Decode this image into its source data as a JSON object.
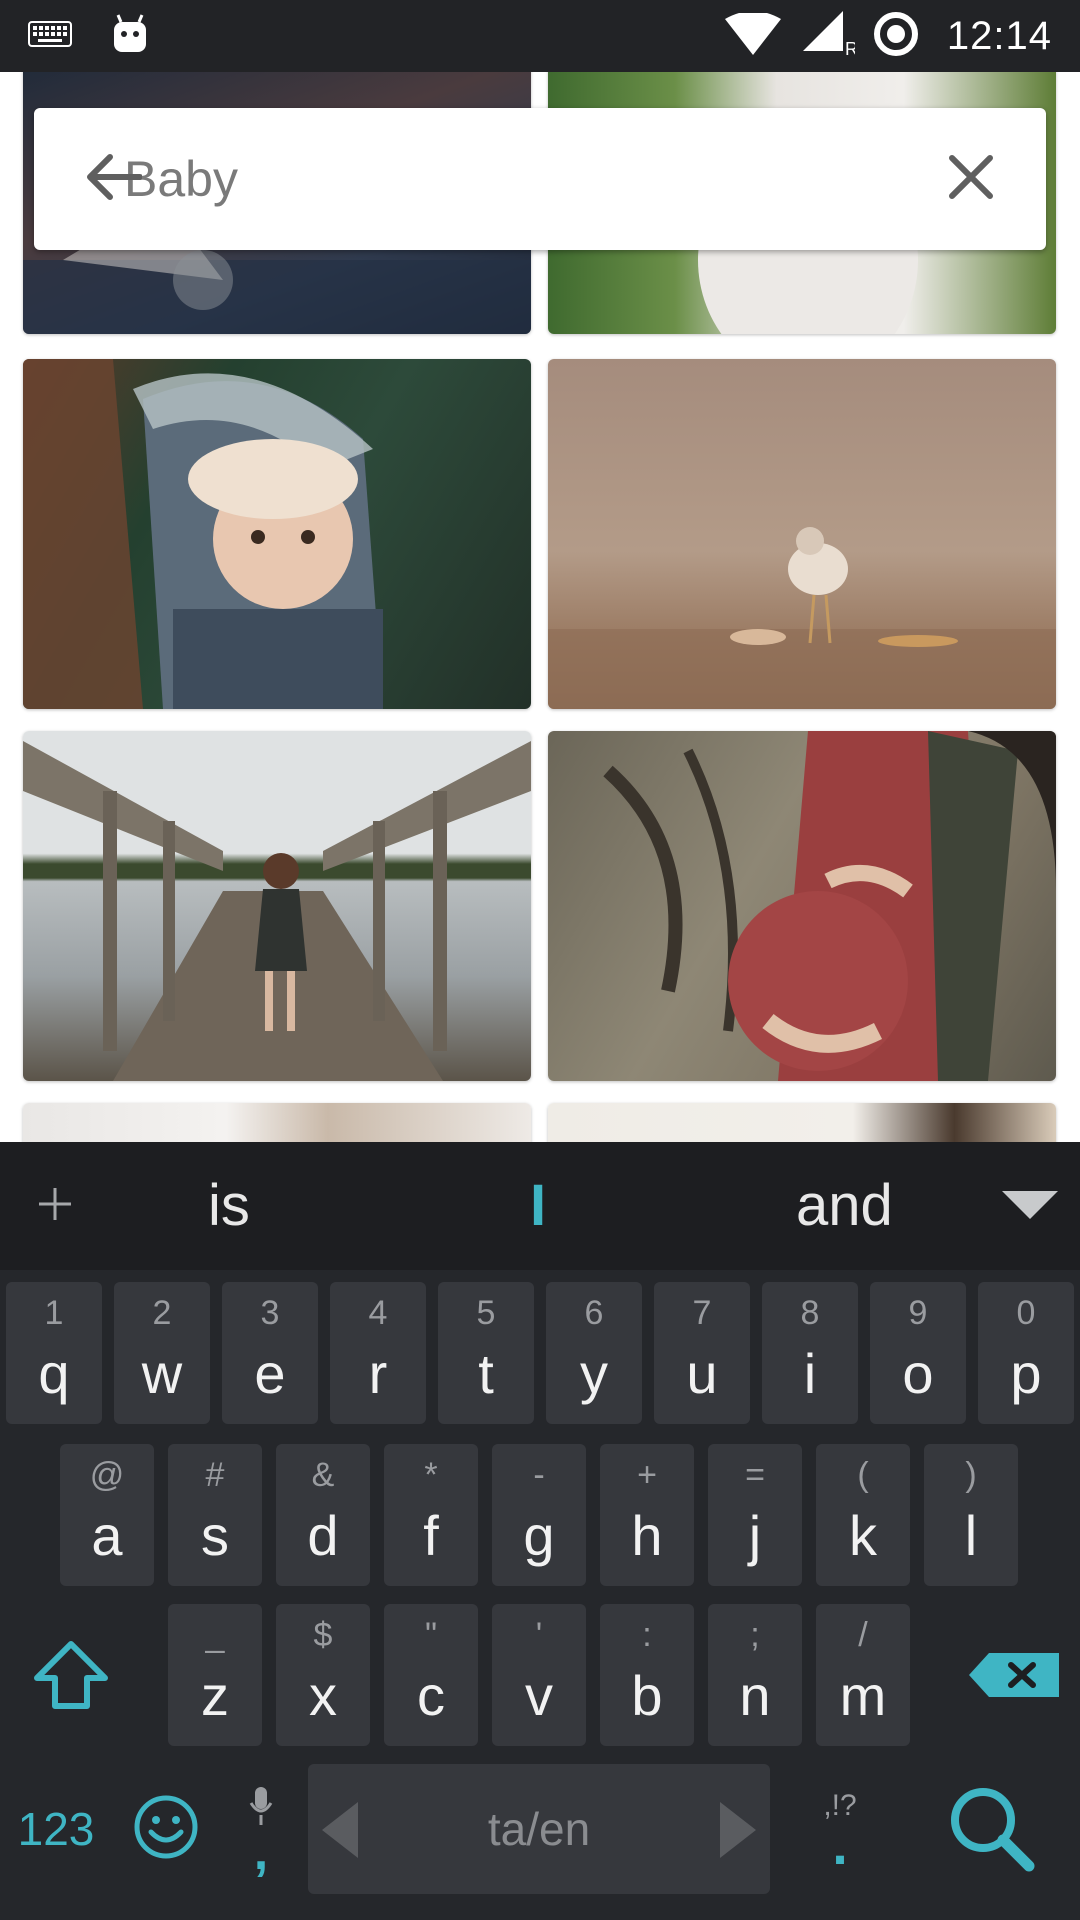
{
  "status_bar": {
    "time": "12:14",
    "icons": [
      "keyboard-icon",
      "android-icon",
      "wifi-icon",
      "signal-icon",
      "sync-icon"
    ]
  },
  "search": {
    "query": "Baby",
    "back_icon": "arrow-left-icon",
    "clear_icon": "close-icon"
  },
  "photos": [
    {
      "name": "photo-top-left",
      "colors": [
        "#2f3a4e",
        "#6b4a44"
      ]
    },
    {
      "name": "photo-top-right",
      "colors": [
        "#5a7a3a",
        "#e7e4e0"
      ]
    },
    {
      "name": "photo-baby-in-carrier",
      "colors": [
        "#2d4a3a",
        "#5b6b7a"
      ]
    },
    {
      "name": "photo-bird-on-sand",
      "colors": [
        "#b39b88",
        "#9a7a62"
      ]
    },
    {
      "name": "photo-child-on-pier",
      "colors": [
        "#dfe2e3",
        "#5b5449"
      ]
    },
    {
      "name": "photo-pregnant-woman",
      "colors": [
        "#7e7564",
        "#9a3f3f"
      ]
    },
    {
      "name": "photo-bottom-left",
      "colors": [
        "#e9e7e5",
        "#c9b9a9"
      ]
    },
    {
      "name": "photo-bottom-right",
      "colors": [
        "#efece6",
        "#4a3a2e"
      ]
    }
  ],
  "keyboard": {
    "suggestions": {
      "add_icon": "plus-icon",
      "left": "is",
      "middle": "I",
      "right": "and",
      "expand_icon": "triangle-down-icon"
    },
    "row1": [
      {
        "hint": "1",
        "key": "q"
      },
      {
        "hint": "2",
        "key": "w"
      },
      {
        "hint": "3",
        "key": "e"
      },
      {
        "hint": "4",
        "key": "r"
      },
      {
        "hint": "5",
        "key": "t"
      },
      {
        "hint": "6",
        "key": "y"
      },
      {
        "hint": "7",
        "key": "u"
      },
      {
        "hint": "8",
        "key": "i"
      },
      {
        "hint": "9",
        "key": "o"
      },
      {
        "hint": "0",
        "key": "p"
      }
    ],
    "row2": [
      {
        "hint": "@",
        "key": "a"
      },
      {
        "hint": "#",
        "key": "s"
      },
      {
        "hint": "&",
        "key": "d"
      },
      {
        "hint": "*",
        "key": "f"
      },
      {
        "hint": "-",
        "key": "g"
      },
      {
        "hint": "+",
        "key": "h"
      },
      {
        "hint": "=",
        "key": "j"
      },
      {
        "hint": "(",
        "key": "k"
      },
      {
        "hint": ")",
        "key": "l"
      }
    ],
    "row3": [
      {
        "hint": "_",
        "key": "z"
      },
      {
        "hint": "$",
        "key": "x"
      },
      {
        "hint": "\"",
        "key": "c"
      },
      {
        "hint": "'",
        "key": "v"
      },
      {
        "hint": ":",
        "key": "b"
      },
      {
        "hint": ";",
        "key": "n"
      },
      {
        "hint": "/",
        "key": "m"
      }
    ],
    "bottom": {
      "numbers_label": "123",
      "comma_label": ",",
      "space_label": "ta/en",
      "period_hint": ",!?",
      "period_label": ".",
      "accent_color": "#3fb5c4"
    }
  }
}
